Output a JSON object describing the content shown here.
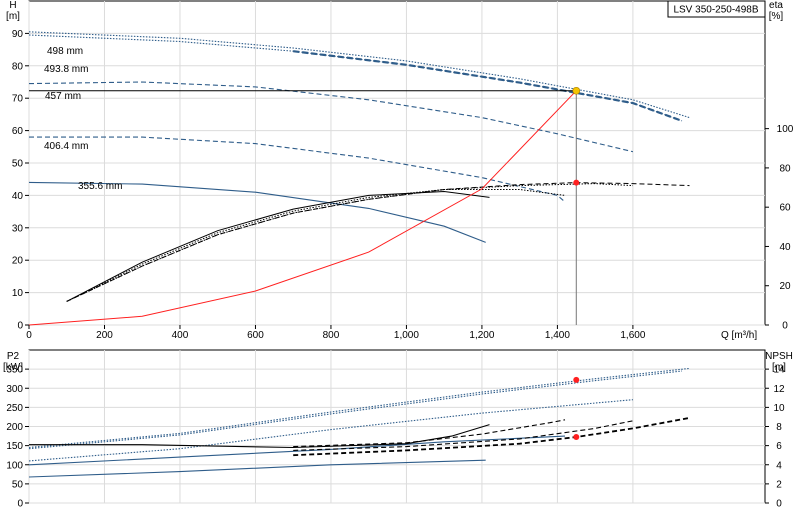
{
  "pump_label": "LSV 350-250-498B",
  "colors": {
    "blue": "#2f5d8a",
    "dark": "#000000",
    "red": "#ff2020",
    "op_point": "#f5c400",
    "grid": "#dcdcdc"
  },
  "chart_data": [
    {
      "type": "line",
      "name": "head-efficiency",
      "x_label": "Q [m³/h]",
      "y_left_label": [
        "H",
        "[m]"
      ],
      "y_right_label": [
        "eta",
        "[%]"
      ],
      "xlim": [
        0,
        1950
      ],
      "ylim_left": [
        0,
        100
      ],
      "ylim_right": [
        0,
        165
      ],
      "x_ticks": [
        0,
        200,
        400,
        600,
        800,
        1000,
        1200,
        1400,
        1600
      ],
      "x_tick_labels": [
        "0",
        "200",
        "400",
        "600",
        "800",
        "1,000",
        "1,200",
        "1,400",
        "1,600"
      ],
      "y_left_ticks": [
        0,
        10,
        20,
        30,
        40,
        50,
        60,
        70,
        80,
        90
      ],
      "y_right_ticks": [
        0,
        20,
        40,
        60,
        80,
        100
      ],
      "grid": true,
      "head_curves": [
        {
          "label": "498 mm",
          "style": "dotted",
          "points": [
            [
              0,
              90.5
            ],
            [
              400,
              88.5
            ],
            [
              700,
              85.5
            ],
            [
              1000,
              81.5
            ],
            [
              1300,
              76
            ],
            [
              1600,
              69.5
            ],
            [
              1750,
              64
            ]
          ]
        },
        {
          "label": "493.8 mm",
          "style": "dotted",
          "points": [
            [
              0,
              89.5
            ],
            [
              400,
              87.5
            ],
            [
              700,
              84.5
            ],
            [
              1000,
              80.3
            ],
            [
              1300,
              74.8
            ],
            [
              1600,
              68.5
            ],
            [
              1730,
              63
            ]
          ]
        },
        {
          "label": "457 mm",
          "style": "dashed",
          "points": [
            [
              0,
              74.5
            ],
            [
              300,
              75
            ],
            [
              600,
              73.5
            ],
            [
              900,
              69.5
            ],
            [
              1200,
              64
            ],
            [
              1400,
              59
            ],
            [
              1600,
              53.5
            ]
          ]
        },
        {
          "label": "406.4 mm",
          "style": "dashed",
          "points": [
            [
              0,
              58
            ],
            [
              300,
              58
            ],
            [
              600,
              56
            ],
            [
              900,
              51.5
            ],
            [
              1200,
              45.5
            ],
            [
              1400,
              40
            ],
            [
              1420,
              38
            ]
          ]
        },
        {
          "label": "355.6 mm",
          "style": "solid",
          "points": [
            [
              0,
              44
            ],
            [
              300,
              43.5
            ],
            [
              600,
              41
            ],
            [
              900,
              36
            ],
            [
              1100,
              30.5
            ],
            [
              1210,
              25.5
            ]
          ]
        }
      ],
      "duty_line_head": 72.3,
      "eta_curves": [
        {
          "style": "solid",
          "points": [
            [
              100,
              12
            ],
            [
              300,
              32
            ],
            [
              500,
              48
            ],
            [
              700,
              59
            ],
            [
              900,
              66
            ],
            [
              1100,
              68
            ],
            [
              1220,
              65
            ]
          ]
        },
        {
          "style": "dotted",
          "points": [
            [
              100,
              12
            ],
            [
              300,
              31
            ],
            [
              500,
              47
            ],
            [
              700,
              58
            ],
            [
              900,
              65
            ],
            [
              1100,
              69
            ],
            [
              1300,
              69
            ],
            [
              1420,
              66
            ]
          ]
        },
        {
          "style": "dotted",
          "points": [
            [
              100,
              12
            ],
            [
              300,
              30
            ],
            [
              500,
              46
            ],
            [
              700,
              57
            ],
            [
              900,
              64
            ],
            [
              1100,
              69
            ],
            [
              1300,
              71
            ],
            [
              1500,
              72
            ],
            [
              1600,
              71
            ]
          ]
        },
        {
          "style": "dashed",
          "points": [
            [
              100,
              12
            ],
            [
              300,
              30
            ],
            [
              500,
              46
            ],
            [
              700,
              57
            ],
            [
              900,
              64
            ],
            [
              1100,
              69
            ],
            [
              1300,
              71.5
            ],
            [
              1450,
              72.5
            ],
            [
              1600,
              72
            ],
            [
              1750,
              71
            ]
          ]
        }
      ],
      "system_curve": {
        "points": [
          [
            0,
            0
          ],
          [
            300,
            2.7
          ],
          [
            600,
            10.5
          ],
          [
            900,
            22.5
          ],
          [
            1200,
            42
          ],
          [
            1450,
            72.3
          ]
        ]
      },
      "operating_point": {
        "q": 1450,
        "h": 72.3,
        "eta": 72.5
      }
    },
    {
      "type": "line",
      "name": "power-npsh",
      "y_left_label": [
        "P2",
        "[kW]"
      ],
      "y_right_label": [
        "NPSH",
        "[m]"
      ],
      "xlim": [
        0,
        1950
      ],
      "ylim_left": [
        0,
        400
      ],
      "ylim_right": [
        0,
        16
      ],
      "y_left_ticks": [
        0,
        50,
        100,
        150,
        200,
        250,
        300,
        350
      ],
      "y_right_ticks": [
        0,
        2,
        4,
        6,
        8,
        10,
        12,
        14
      ],
      "grid": true,
      "power_curves": [
        {
          "style": "dotted",
          "points": [
            [
              0,
              145
            ],
            [
              400,
              182
            ],
            [
              800,
              238
            ],
            [
              1200,
              290
            ],
            [
              1500,
              325
            ],
            [
              1750,
              352
            ]
          ]
        },
        {
          "style": "dotted",
          "points": [
            [
              0,
              142
            ],
            [
              400,
              178
            ],
            [
              800,
              233
            ],
            [
              1200,
              285
            ],
            [
              1500,
              320
            ],
            [
              1730,
              345
            ]
          ]
        },
        {
          "style": "dotted",
          "points": [
            [
              0,
              110
            ],
            [
              400,
              142
            ],
            [
              800,
              192
            ],
            [
              1200,
              235
            ],
            [
              1600,
              270
            ]
          ]
        },
        {
          "style": "solid",
          "points": [
            [
              0,
              100
            ],
            [
              400,
              120
            ],
            [
              800,
              140
            ],
            [
              1100,
              160
            ],
            [
              1420,
              175
            ]
          ]
        },
        {
          "style": "solid",
          "points": [
            [
              0,
              68
            ],
            [
              400,
              82
            ],
            [
              800,
              100
            ],
            [
              1210,
              112
            ]
          ]
        }
      ],
      "npsh_curves": [
        {
          "style": "solid",
          "points": [
            [
              0,
              6.1
            ],
            [
              300,
              6.1
            ],
            [
              700,
              5.8
            ],
            [
              1000,
              6.2
            ],
            [
              1120,
              7.0
            ],
            [
              1220,
              8.2
            ]
          ]
        },
        {
          "style": "dashed",
          "points": [
            [
              700,
              5.9
            ],
            [
              1000,
              6.3
            ],
            [
              1200,
              7.2
            ],
            [
              1380,
              8.4
            ],
            [
              1420,
              8.7
            ]
          ]
        },
        {
          "style": "dashed",
          "points": [
            [
              700,
              5.5
            ],
            [
              1000,
              5.9
            ],
            [
              1300,
              6.7
            ],
            [
              1500,
              7.8
            ],
            [
              1600,
              8.6
            ]
          ]
        },
        {
          "style": "dashed",
          "points": [
            [
              700,
              5.0
            ],
            [
              1000,
              5.5
            ],
            [
              1300,
              6.2
            ],
            [
              1450,
              6.9
            ],
            [
              1600,
              7.8
            ],
            [
              1750,
              8.9
            ]
          ]
        }
      ],
      "operating_points": {
        "power_q": 1450,
        "power_value": 322,
        "npsh_q": 1450,
        "npsh_value": 6.9
      }
    }
  ]
}
